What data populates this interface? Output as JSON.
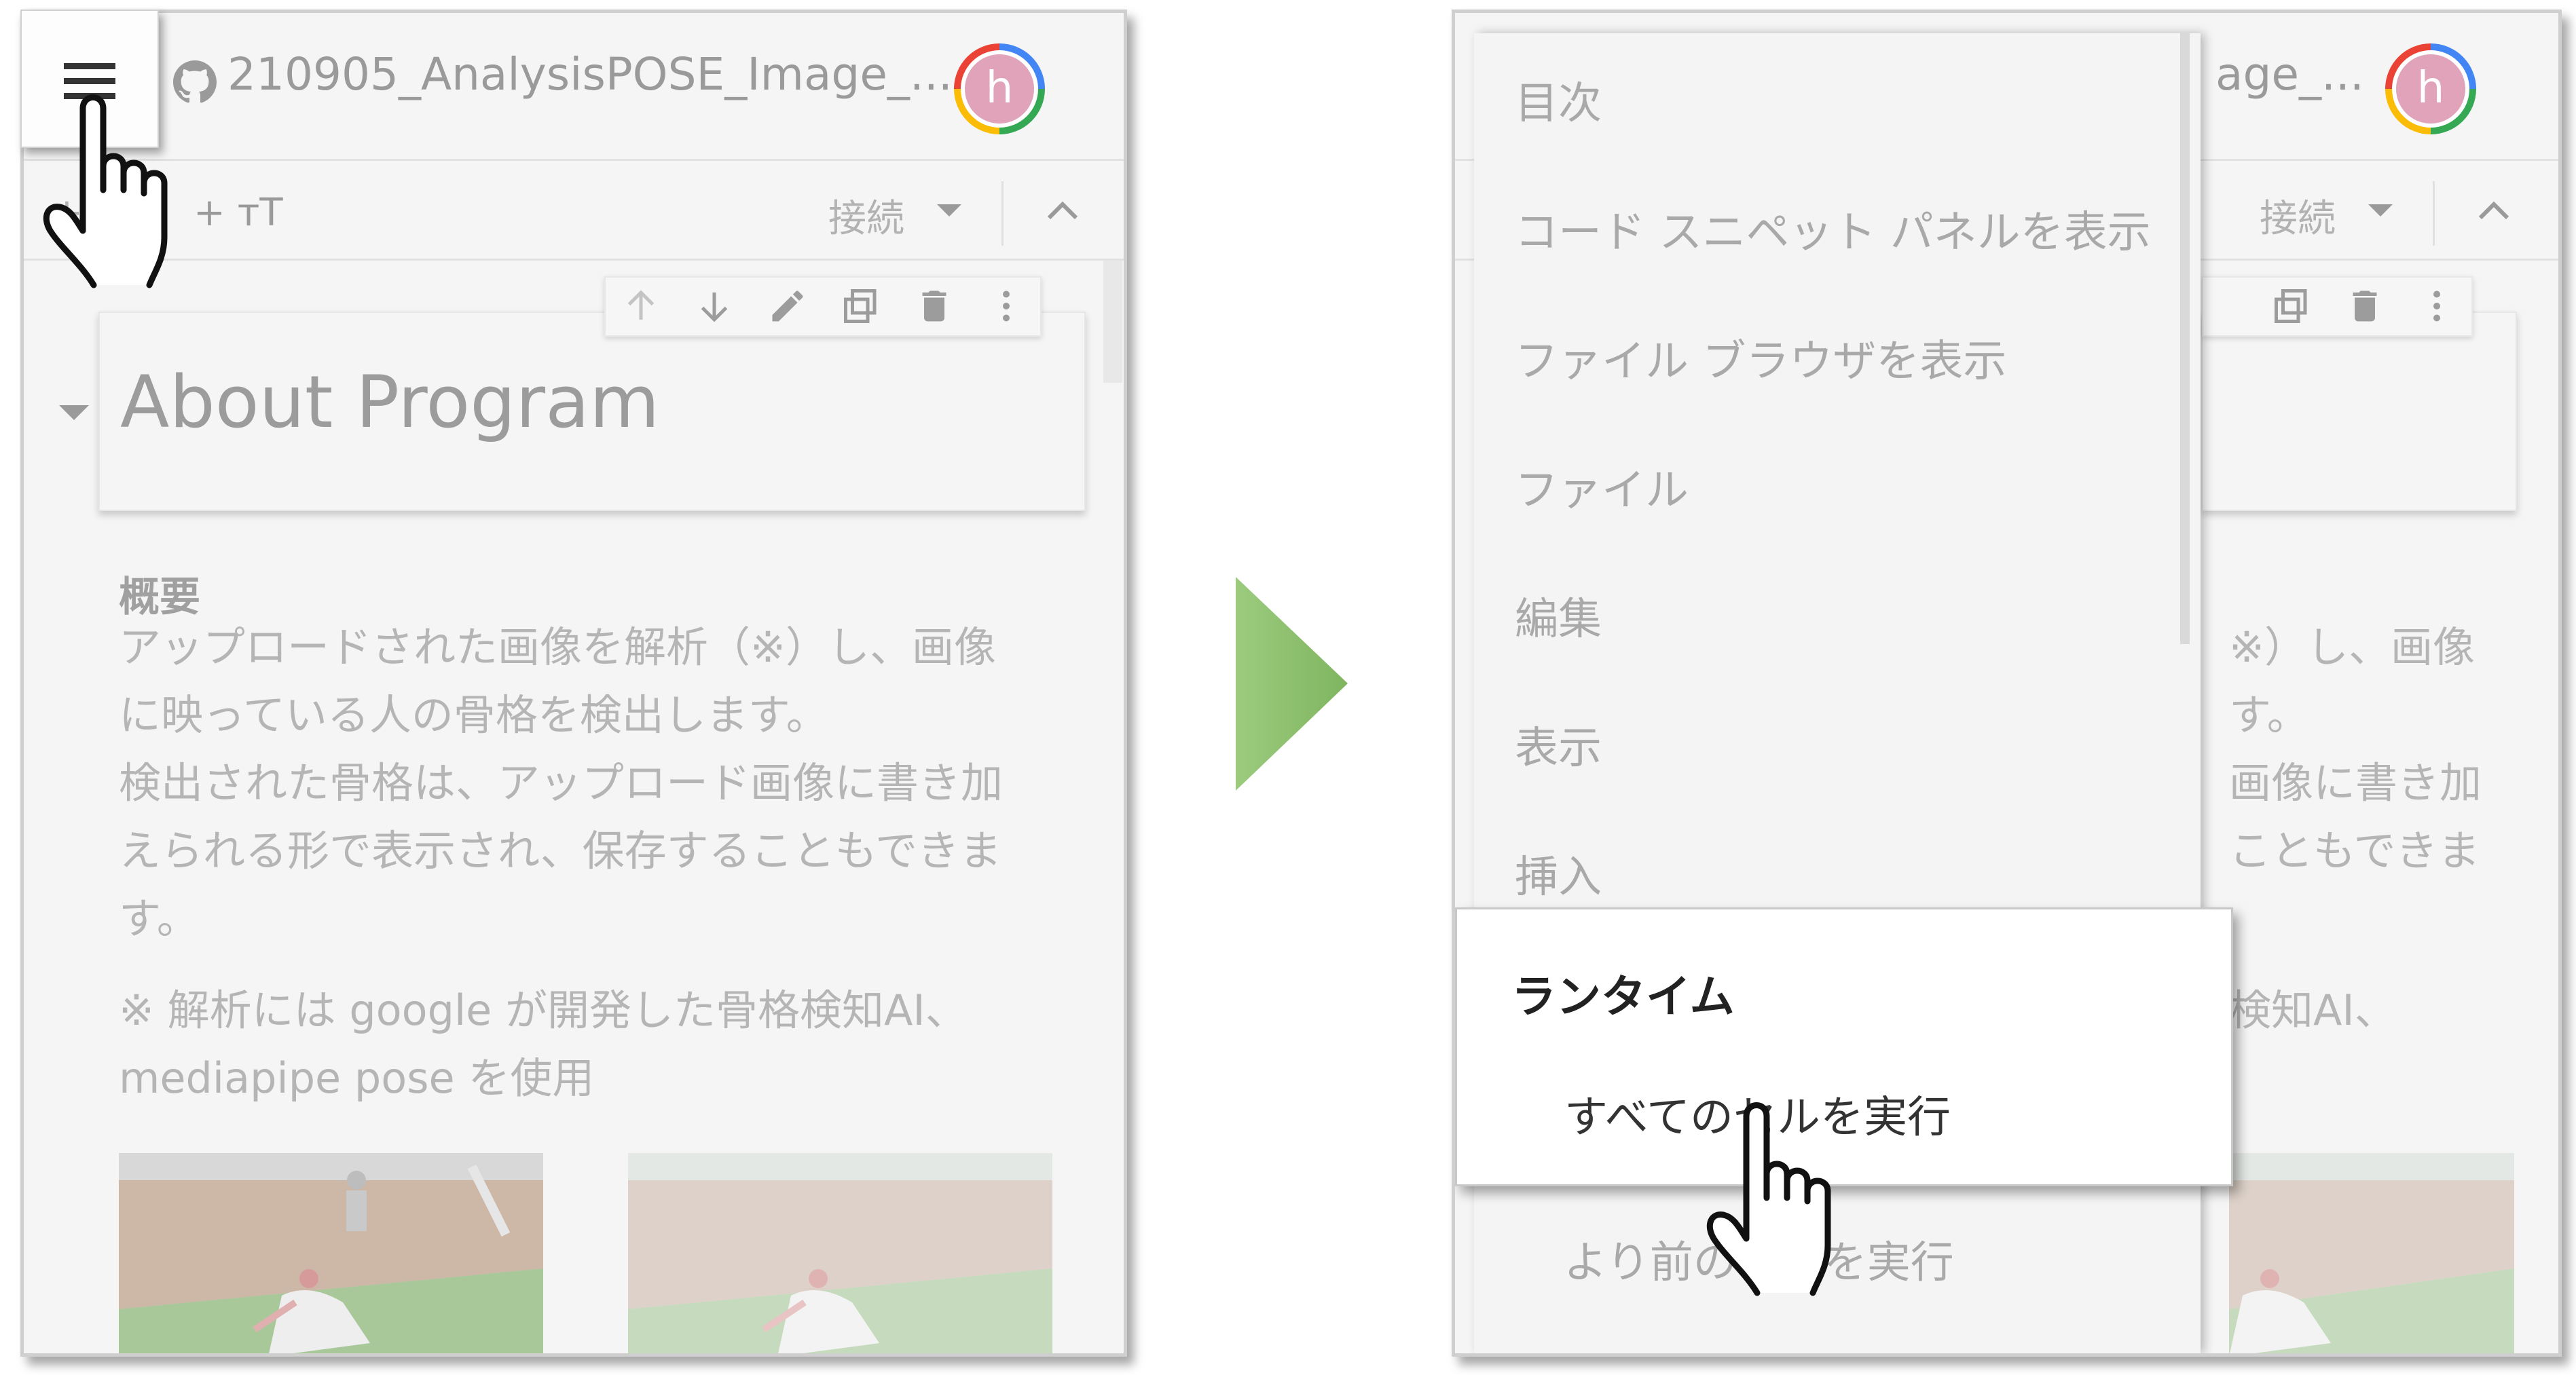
{
  "left": {
    "notebook_title": "210905_AnalysisPOSE_Image_...",
    "avatar_letter": "h",
    "toolbar": {
      "add_code": "+ <>",
      "add_text": "+ тT",
      "connect_label": "接続"
    },
    "cell_tools": [
      "arrow-up-icon",
      "arrow-down-icon",
      "edit-icon",
      "mirror-icon",
      "delete-icon",
      "more-vert-icon"
    ],
    "heading": "About Program",
    "summary_label": "概要",
    "paragraph_lines": [
      "アップロードされた画像を解析（※）し、画像",
      "に映っている人の骨格を検出します。",
      "検出された骨格は、アップロード画像に書き加",
      "えられる形で表示され、保存することもできま",
      "す。"
    ],
    "note_lines": [
      "※ 解析には google が開発した骨格検知AI、",
      "mediapipe pose を使用"
    ]
  },
  "right": {
    "menu_items": [
      "目次",
      "コード スニペット パネルを表示",
      "ファイル ブラウザを表示",
      "ファイル",
      "編集",
      "表示",
      "挿入"
    ],
    "runtime_title": "ランタイム",
    "run_all_label": "すべてのセルを実行",
    "run_before_label": "より前のセルを実行",
    "bg_title_fragment": "age_...",
    "avatar_letter": "h",
    "connect_label": "接続",
    "bg_text_lines": [
      "※）し、画像",
      "す。",
      "画像に書き加",
      "こともできま",
      "検知AI、"
    ]
  },
  "colors": {
    "arrow_green": "#8cbf6d",
    "avatar_pink": "#e0a3b9"
  }
}
